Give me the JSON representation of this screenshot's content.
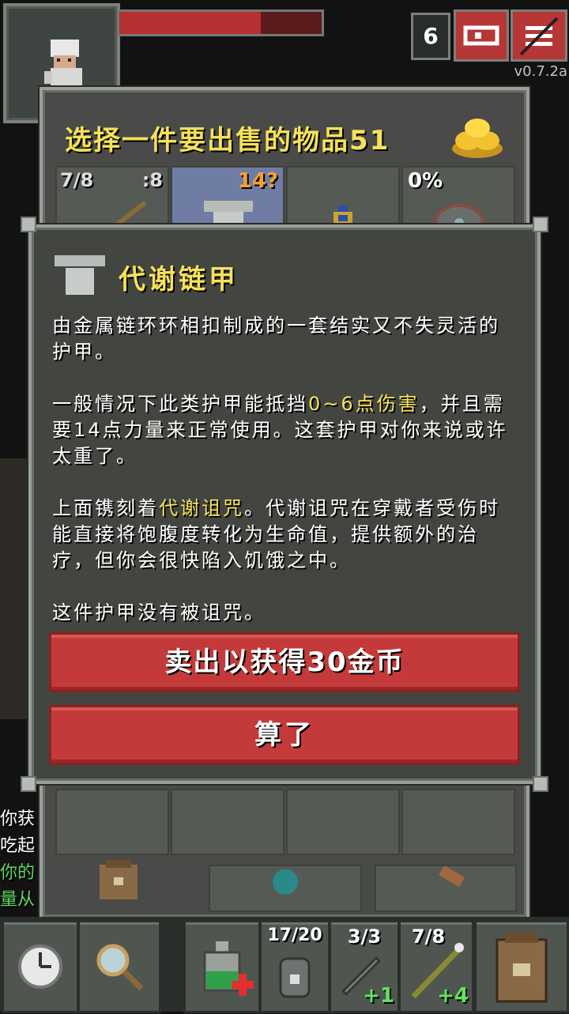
{
  "hud": {
    "depth": "6",
    "version": "v0.7.2a",
    "journal_icon": "journal-icon",
    "menu_icon": "menu-icon"
  },
  "shop": {
    "title": "选择一件要出售的物品",
    "gold": "51",
    "slots": [
      {
        "top_left": "7/8",
        "top_right": ":8",
        "icon": "staff-icon"
      },
      {
        "top_left": "",
        "top_right": "14?",
        "icon": "chainmail-icon",
        "selected": true
      },
      {
        "top_left": "",
        "top_right": "",
        "icon": "potion-blue-icon"
      },
      {
        "top_left": "0%",
        "top_right": "",
        "icon": "shield-icon"
      }
    ]
  },
  "item": {
    "name": "代谢链甲",
    "desc1": "由金属链环环相扣制成的一套结实又不失灵活的护甲。",
    "desc2_a": "一般情况下此类护甲能抵挡",
    "desc2_hl": "0~6点伤害",
    "desc2_b": "，并且需要14点力量来正常使用。这套护甲对你来说或许太重了。",
    "desc3_a": "上面镌刻着",
    "desc3_hl": "代谢诅咒",
    "desc3_b": "。代谢诅咒在穿戴者受伤时能直接将饱腹度转化为生命值，提供额外的治疗，但你会很快陷入饥饿之中。",
    "desc4": "这件护甲没有被诅咒。"
  },
  "buttons": {
    "sell": "卖出以获得30金币",
    "cancel": "算了"
  },
  "log": {
    "line1": "你获",
    "line2": "吃起",
    "line3": "你的",
    "line4": "量从"
  },
  "toolbar": {
    "quickslot2_count": "17/20",
    "quickslot3_count": "3/3",
    "quickslot3_bonus": "+1",
    "quickslot4_count": "7/8",
    "quickslot4_bonus": "+4"
  },
  "colors": {
    "highlight": "#f5e15a",
    "button_red": "#c43a3a",
    "panel": "#4a4a48"
  }
}
